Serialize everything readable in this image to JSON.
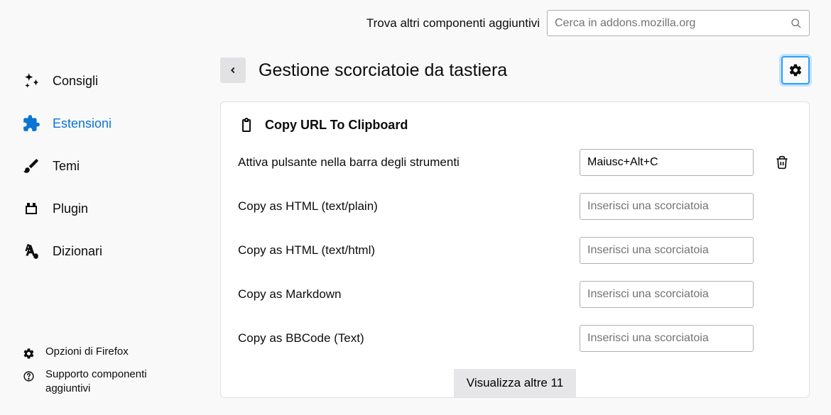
{
  "topbar": {
    "find_label": "Trova altri componenti aggiuntivi",
    "search_placeholder": "Cerca in addons.mozilla.org"
  },
  "sidebar": {
    "items": [
      {
        "label": "Consigli"
      },
      {
        "label": "Estensioni"
      },
      {
        "label": "Temi"
      },
      {
        "label": "Plugin"
      },
      {
        "label": "Dizionari"
      }
    ],
    "footer": [
      {
        "label": "Opzioni di Firefox"
      },
      {
        "label": "Supporto componenti aggiuntivi"
      }
    ]
  },
  "header": {
    "title": "Gestione scorciatoie da tastiera"
  },
  "extension": {
    "name": "Copy URL To Clipboard",
    "shortcuts": [
      {
        "label": "Attiva pulsante nella barra degli strumenti",
        "value": "Maiusc+Alt+C",
        "has_delete": true
      },
      {
        "label": "Copy as HTML (text/plain)",
        "value": "",
        "placeholder": "Inserisci una scorciatoia",
        "has_delete": false
      },
      {
        "label": "Copy as HTML (text/html)",
        "value": "",
        "placeholder": "Inserisci una scorciatoia",
        "has_delete": false
      },
      {
        "label": "Copy as Markdown",
        "value": "",
        "placeholder": "Inserisci una scorciatoia",
        "has_delete": false
      },
      {
        "label": "Copy as BBCode (Text)",
        "value": "",
        "placeholder": "Inserisci una scorciatoia",
        "has_delete": false
      }
    ],
    "show_more": "Visualizza altre 11"
  }
}
